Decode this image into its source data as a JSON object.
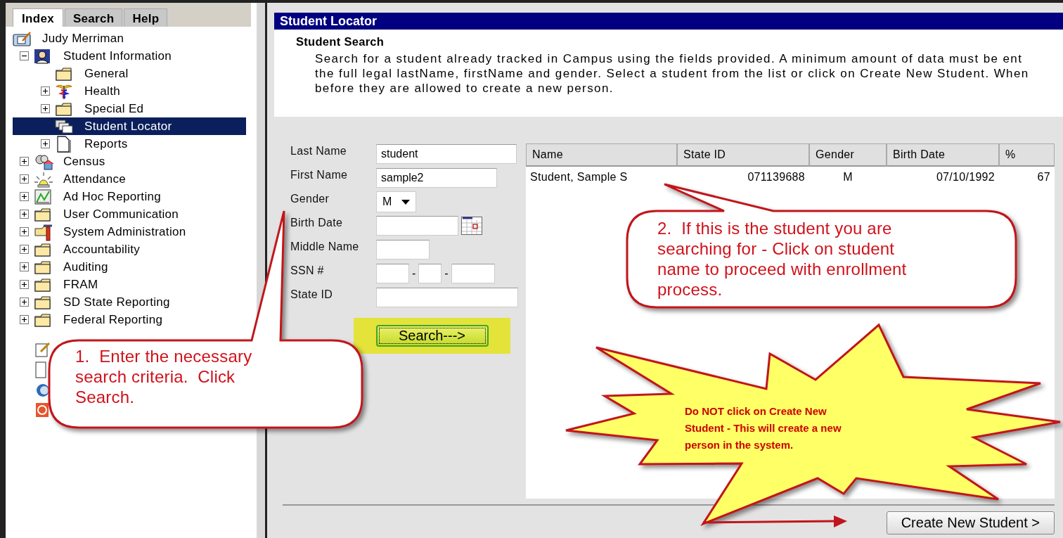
{
  "sidebar": {
    "tabs": [
      {
        "label": "Index",
        "selected": true
      },
      {
        "label": "Search",
        "selected": false
      },
      {
        "label": "Help",
        "selected": false
      }
    ],
    "tree": {
      "label": "Judy Merriman",
      "kind": "user",
      "selected": false,
      "children": [
        {
          "label": "Student Information",
          "kind": "student",
          "expanded": true,
          "selected": false,
          "children": [
            {
              "label": "General",
              "kind": "folder",
              "selected": false
            },
            {
              "label": "Health",
              "kind": "health",
              "expanded": false,
              "selected": false
            },
            {
              "label": "Special Ed",
              "kind": "folder",
              "expanded": false,
              "selected": false
            },
            {
              "label": "Student Locator",
              "kind": "pages",
              "selected": true
            },
            {
              "label": "Reports",
              "kind": "document",
              "expanded": false,
              "selected": false
            }
          ]
        },
        {
          "label": "Census",
          "kind": "census",
          "expanded": false,
          "selected": false
        },
        {
          "label": "Attendance",
          "kind": "bell",
          "expanded": false,
          "selected": false
        },
        {
          "label": "Ad Hoc Reporting",
          "kind": "chart",
          "expanded": false,
          "selected": false
        },
        {
          "label": "User Communication",
          "kind": "folder",
          "expanded": false,
          "selected": false
        },
        {
          "label": "System Administration",
          "kind": "tools",
          "expanded": false,
          "selected": false
        },
        {
          "label": "Accountability",
          "kind": "folder",
          "expanded": false,
          "selected": false
        },
        {
          "label": "Auditing",
          "kind": "folder",
          "expanded": false,
          "selected": false
        },
        {
          "label": "FRAM",
          "kind": "folder",
          "expanded": false,
          "selected": false
        },
        {
          "label": "SD State Reporting",
          "kind": "folder",
          "expanded": false,
          "selected": false
        },
        {
          "label": "Federal Reporting",
          "kind": "folder",
          "expanded": false,
          "selected": false
        }
      ]
    }
  },
  "main": {
    "title": "Student Locator",
    "section_title": "Student Search",
    "description_lines": [
      "Search for a student already tracked in Campus using the fields provided. A minimum amount of data must be ent",
      "the full legal lastName, firstName and gender. Select a student from the list or click on Create New Student. When",
      "before they are allowed to create a new person."
    ],
    "form": [
      {
        "kind": "text",
        "label": "Last Name",
        "value": "student"
      },
      {
        "kind": "text",
        "label": "First Name",
        "value": "sample2"
      },
      {
        "kind": "select",
        "label": "Gender",
        "value": "M"
      },
      {
        "kind": "date",
        "label": "Birth Date"
      },
      {
        "kind": "text",
        "label": "Middle Name"
      },
      {
        "kind": "ssn",
        "label": "SSN #",
        "separators": [
          "-",
          "-"
        ]
      },
      {
        "kind": "text",
        "label": "State ID"
      }
    ],
    "search_button": "Search--->",
    "table": {
      "columns": [
        "Name",
        "State ID",
        "Gender",
        "Birth Date",
        "%"
      ],
      "rows": [
        [
          "Student, Sample S",
          "071139688",
          "M",
          "07/10/1992",
          "67"
        ]
      ]
    },
    "create_button": "Create New Student >"
  },
  "annotations": [
    {
      "kind": "callout",
      "text": "1.  Enter the necessary\nsearch criteria.  Click\nSearch."
    },
    {
      "kind": "callout",
      "text": "2.  If this is the student you are\nsearching for - Click on student\nname to proceed with enrollment\nprocess."
    },
    {
      "kind": "starburst",
      "text": "Do NOT click on Create New\nStudent - This will create a new\nperson in the system."
    }
  ]
}
